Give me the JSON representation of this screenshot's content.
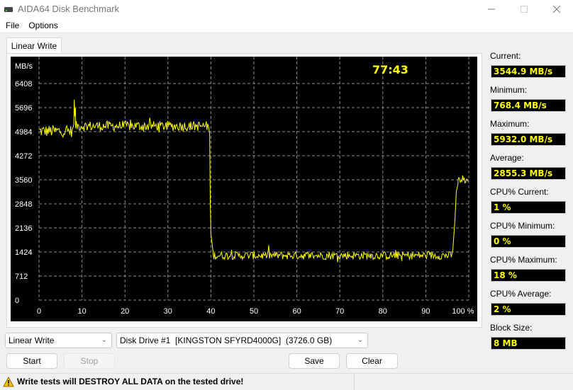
{
  "window": {
    "title": "AIDA64 Disk Benchmark",
    "icon": "disk-drive-icon",
    "controls": {
      "minimize": "minimize-icon",
      "maximize": "maximize-icon",
      "close": "close-icon"
    }
  },
  "menu": {
    "items": [
      "File",
      "Options"
    ]
  },
  "tabs": [
    {
      "label": "Linear Write",
      "active": true
    }
  ],
  "chart": {
    "elapsed": "77:43",
    "line_color": "#ffff00",
    "background": "#000000"
  },
  "chart_data": {
    "type": "line",
    "title": "",
    "xlabel": "%",
    "ylabel": "MB/s",
    "xlim": [
      0,
      100
    ],
    "ylim": [
      0,
      6408
    ],
    "x_ticks": [
      "0",
      "10",
      "20",
      "30",
      "40",
      "50",
      "60",
      "70",
      "80",
      "90",
      "100 %"
    ],
    "y_ticks": [
      "0",
      "712",
      "1424",
      "2136",
      "2848",
      "3560",
      "4272",
      "4984",
      "5696",
      "6408"
    ],
    "grid": true,
    "legend": "none",
    "series": [
      {
        "name": "Linear Write",
        "segments": [
          {
            "x_from": 0,
            "x_to": 8,
            "mean": 5000,
            "noise": 180
          },
          {
            "x": 8.2,
            "peak": 5932
          },
          {
            "x_from": 8.5,
            "x_to": 39.5,
            "mean": 5150,
            "noise": 150
          },
          {
            "x_from": 39.5,
            "x_to": 40.5,
            "drop_to": 1450
          },
          {
            "x_from": 40.5,
            "x_to": 96,
            "mean": 1320,
            "noise": 120
          },
          {
            "x_from": 96,
            "x_to": 97.5,
            "rise_to": 3450
          },
          {
            "x_from": 97.5,
            "x_to": 100,
            "mean": 3550,
            "noise": 100
          }
        ],
        "min": 768.4,
        "max": 5932.0,
        "avg": 2855.3,
        "last": 3544.9
      }
    ]
  },
  "stats": [
    {
      "label": "Current:",
      "value": "3544.9 MB/s"
    },
    {
      "label": "Minimum:",
      "value": "768.4 MB/s"
    },
    {
      "label": "Maximum:",
      "value": "5932.0 MB/s"
    },
    {
      "label": "Average:",
      "value": "2855.3 MB/s"
    },
    {
      "label": "CPU% Current:",
      "value": "1 %"
    },
    {
      "label": "CPU% Minimum:",
      "value": "0 %"
    },
    {
      "label": "CPU% Maximum:",
      "value": "18 %"
    },
    {
      "label": "CPU% Average:",
      "value": "2 %"
    },
    {
      "label": "Block Size:",
      "value": "8 MB"
    }
  ],
  "controls": {
    "test_select": "Linear Write",
    "drive_select": "Disk Drive #1  [KINGSTON SFYRD4000G]  (3726.0 GB)",
    "start": "Start",
    "stop": "Stop",
    "save": "Save",
    "clear": "Clear"
  },
  "status": {
    "icon": "warning-icon",
    "message": "Write tests will DESTROY ALL DATA on the tested drive!"
  }
}
